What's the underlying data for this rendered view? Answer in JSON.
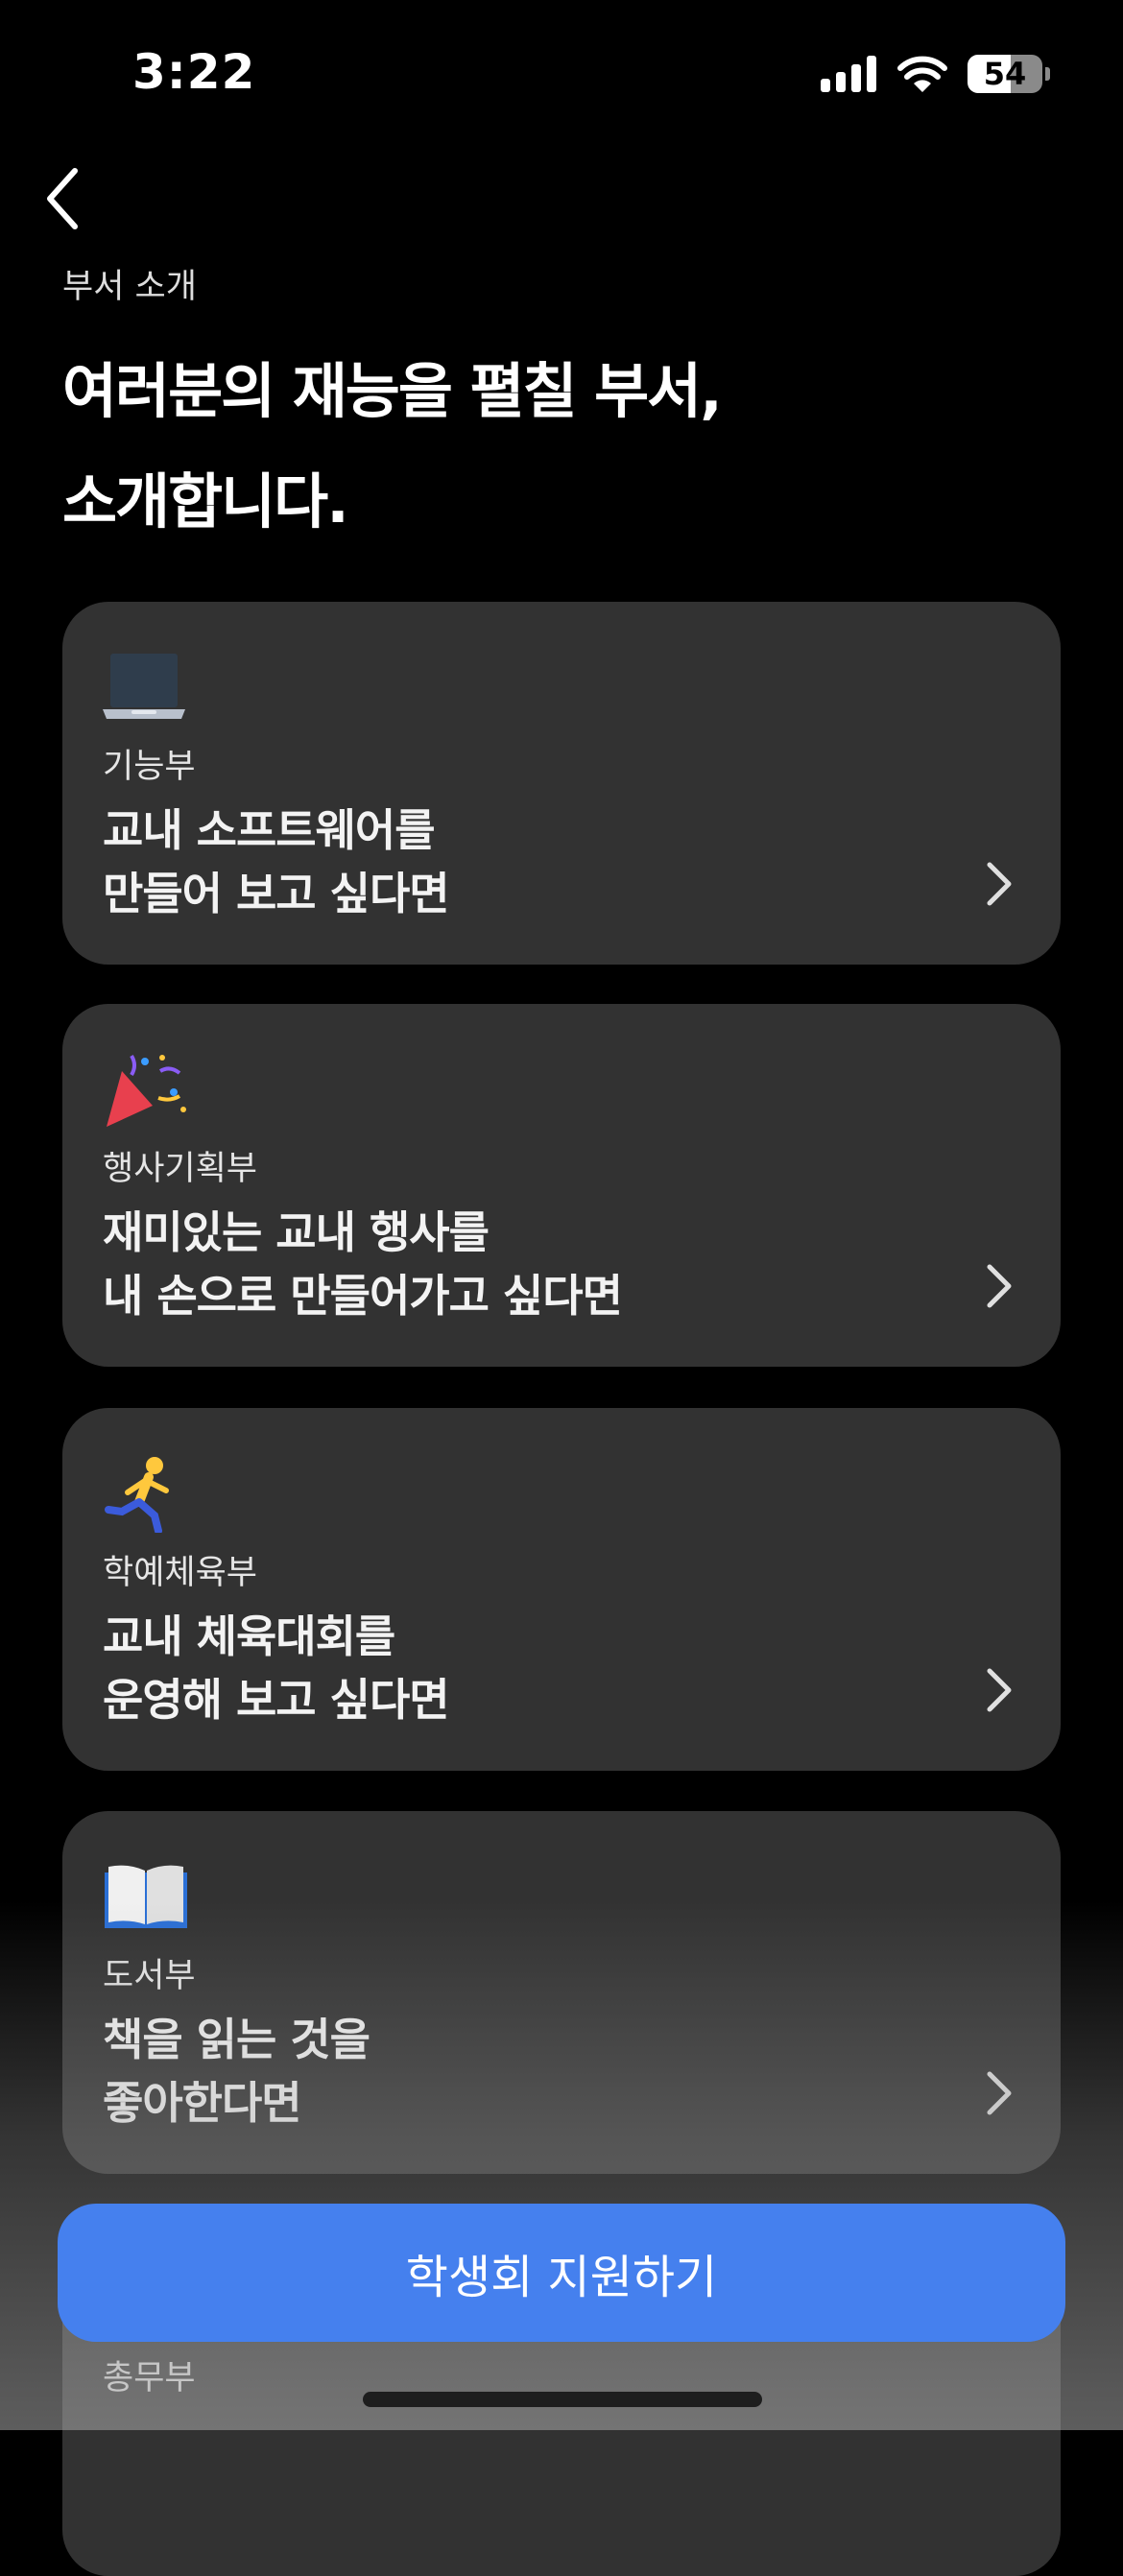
{
  "status_bar": {
    "time": "3:22",
    "battery": "54",
    "icons": [
      "cellular-signal-icon",
      "wifi-icon",
      "battery-icon"
    ]
  },
  "nav": {
    "back_icon": "chevron-left-icon"
  },
  "header": {
    "subtitle": "부서 소개",
    "title_line1": "여러분의 재능을 펼칠 부서,",
    "title_line2": "소개합니다."
  },
  "departments": [
    {
      "icon": "laptop-icon",
      "name": "기능부",
      "description": "교내 소프트웨어를\n만들어 보고 싶다면"
    },
    {
      "icon": "party-popper-icon",
      "name": "행사기획부",
      "description": "재미있는 교내 행사를\n내 손으로 만들어가고 싶다면"
    },
    {
      "icon": "running-person-icon",
      "name": "학예체육부",
      "description": "교내 체육대회를\n운영해 보고 싶다면"
    },
    {
      "icon": "open-book-icon",
      "name": "도서부",
      "description": "책을 읽는 것을\n좋아한다면"
    },
    {
      "icon": "",
      "name": "총무부",
      "description": ""
    }
  ],
  "cta": {
    "label": "학생회 지원하기",
    "color": "#4580EE"
  }
}
